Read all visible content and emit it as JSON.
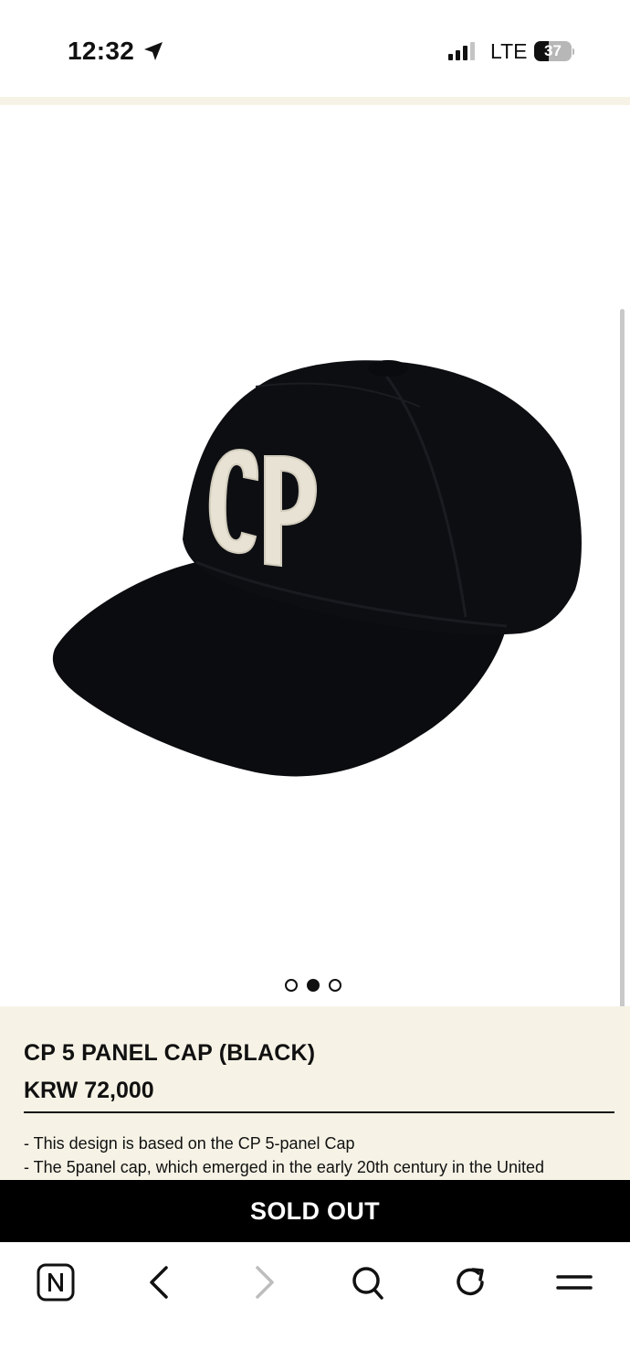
{
  "status_bar": {
    "time": "12:32",
    "network": "LTE",
    "battery": "37"
  },
  "gallery": {
    "image_alt": "CP 5 panel cap black with CP patch",
    "cap_logo": "CP",
    "total_slides": 3,
    "active_slide": 2
  },
  "product": {
    "name": "CP 5 PANEL CAP (BLACK)",
    "price": "KRW 72,000",
    "description": [
      "- This design is based on the CP 5-panel Cap",
      "- The 5panel cap, which emerged in the early 20th century in the United"
    ]
  },
  "actions": {
    "sold_out_label": "SOLD OUT"
  },
  "toolbar": {
    "icons": [
      "naver-home-icon",
      "back-icon",
      "forward-icon",
      "search-icon",
      "reload-icon",
      "menu-icon"
    ]
  },
  "colors": {
    "panel_background": "#f6f3e6",
    "sold_out_background": "#000000",
    "cap_color": "#0b0c0f",
    "patch_color": "#e7e2d4"
  }
}
